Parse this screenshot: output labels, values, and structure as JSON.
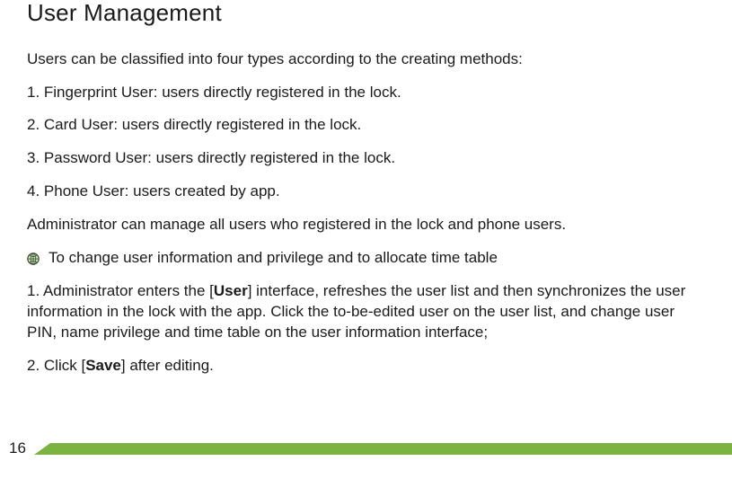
{
  "title": "User Management",
  "intro": "Users can be classified into four types according to the creating methods:",
  "types": [
    "1. Fingerprint User: users directly registered in the lock.",
    "2. Card User: users directly registered in the lock.",
    "3. Password User: users directly registered in the lock.",
    "4. Phone User: users created by app."
  ],
  "admin_note": "Administrator can manage all users who registered in the lock and phone users.",
  "bullet_text": "To change user information and privilege and to allocate time table",
  "step1": {
    "pre": "1. Administrator enters the [",
    "bold": "User",
    "post": "] interface, refreshes the user list and then synchronizes the user information in the lock with the app. Click the to-be-edited user on the user list, and change user PIN, name privilege and time table on the user information interface;"
  },
  "step2": {
    "pre": "2. Click [",
    "bold": "Save",
    "post": "] after editing."
  },
  "page_number": "16"
}
